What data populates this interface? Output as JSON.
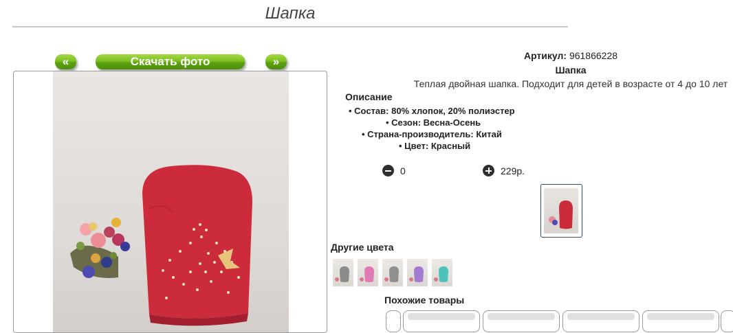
{
  "page": {
    "title": "Шапка"
  },
  "gallery": {
    "prev_label": "«",
    "download_label": "Скачать фото",
    "next_label": "»"
  },
  "product": {
    "article_label": "Артикул:",
    "article_value": "961866228",
    "name": "Шапка",
    "description": "Теплая двойная шапка. Подходит для детей в возрасте от 4 до 10 лет",
    "description_heading": "Описание",
    "properties": [
      "Состав: 80% хлопок, 20% полиэстер",
      "Сезон: Весна-Осень",
      "Страна-производитель: Китай",
      "Цвет: Красный"
    ],
    "quantity": "0",
    "price": "229р."
  },
  "other_colors": {
    "heading": "Другие цвета",
    "swatches": [
      "gray",
      "pink",
      "gray",
      "purple",
      "turquoise"
    ]
  },
  "similar": {
    "heading": "Похожие товары"
  },
  "colors": {
    "hat": "#cc2b3c",
    "accent_green": "#6cb31a",
    "thumb_border": "#2d4a6d"
  }
}
